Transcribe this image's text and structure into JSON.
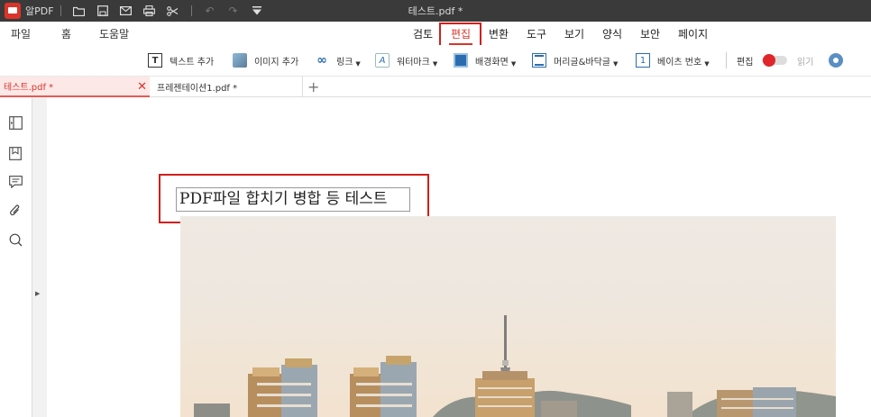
{
  "app": {
    "name": "알PDF",
    "document_title": "테스트.pdf *"
  },
  "menu": {
    "left": [
      "파일",
      "홈",
      "도움말"
    ],
    "tabs": [
      "검토",
      "편집",
      "변환",
      "도구",
      "보기",
      "양식",
      "보안",
      "페이지"
    ],
    "active_tab": "편집"
  },
  "ribbon": {
    "add_text": "텍스트 추가",
    "add_image": "이미지 추가",
    "link": "링크",
    "watermark": "워터마크",
    "background": "배경화면",
    "header_footer": "머리글&바닥글",
    "bates": "베이츠 번호",
    "edit": "편집",
    "read": "읽기"
  },
  "tabs": {
    "active": "테스트.pdf *",
    "second": "프레젠테이션1.pdf *"
  },
  "document": {
    "heading_text": "PDF파일 합치기 병합 등 테스트"
  },
  "colors": {
    "accent": "#d9342b",
    "titlebar": "#3a3a3a"
  },
  "icons": [
    "folder-icon",
    "save-icon",
    "mail-icon",
    "print-icon",
    "scissors-icon",
    "undo-icon",
    "redo-icon",
    "dropdown-icon",
    "close-icon",
    "add-tab-icon",
    "panel-icon",
    "bookmark-icon",
    "comment-icon",
    "attachment-icon",
    "search-icon",
    "gear-icon"
  ]
}
